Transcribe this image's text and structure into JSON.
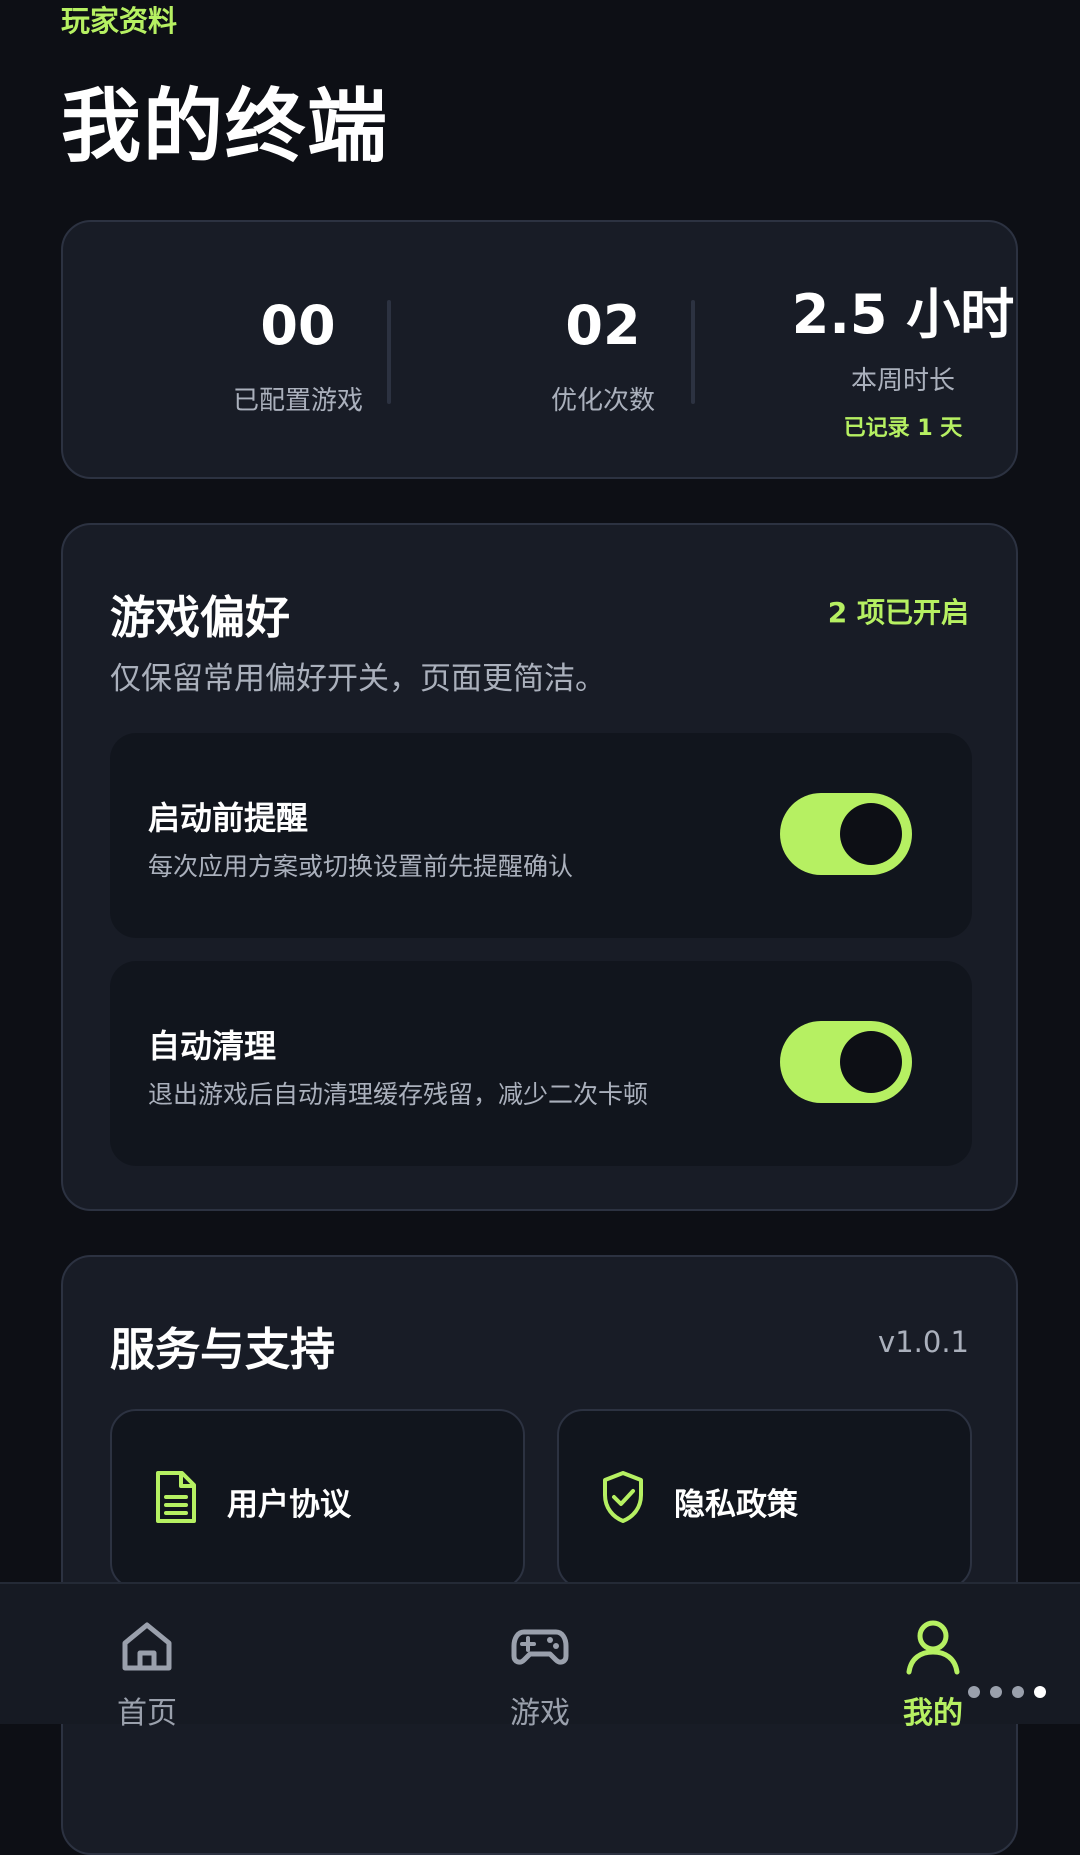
{
  "header": {
    "section_label": "玩家资料",
    "title": "我的终端"
  },
  "stats": {
    "configured_games": {
      "value": "00",
      "label": "已配置游戏"
    },
    "optimizations": {
      "value": "02",
      "label": "优化次数"
    },
    "weekly_time": {
      "value": "2.5 小时",
      "label": "本周时长",
      "sub": "已记录 1 天"
    }
  },
  "preferences": {
    "title": "游戏偏好",
    "enabled_count": "2 项已开启",
    "description": "仅保留常用偏好开关，页面更简洁。",
    "items": [
      {
        "title": "启动前提醒",
        "description": "每次应用方案或切换设置前先提醒确认",
        "enabled": true
      },
      {
        "title": "自动清理",
        "description": "退出游戏后自动清理缓存残留，减少二次卡顿",
        "enabled": true
      }
    ]
  },
  "service": {
    "title": "服务与支持",
    "version": "v1.0.1",
    "links": [
      {
        "label": "用户协议",
        "icon": "document-icon"
      },
      {
        "label": "隐私政策",
        "icon": "shield-check-icon"
      }
    ]
  },
  "nav": {
    "items": [
      {
        "label": "首页",
        "icon": "home-icon"
      },
      {
        "label": "游戏",
        "icon": "gamepad-icon"
      },
      {
        "label": "我的",
        "icon": "user-icon",
        "active": true
      }
    ]
  },
  "colors": {
    "accent": "#b6f062",
    "background": "#0d0f15",
    "card": "#181c26"
  }
}
